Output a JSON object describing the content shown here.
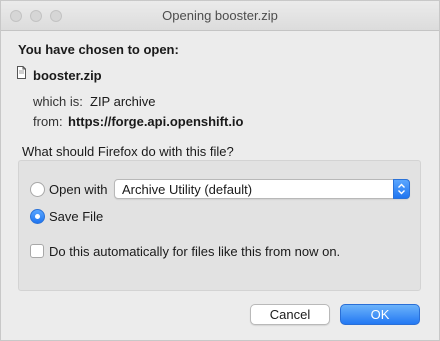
{
  "window": {
    "title": "Opening booster.zip"
  },
  "intro": {
    "heading": "You have chosen to open:"
  },
  "file": {
    "icon": "document-icon",
    "name": "booster.zip",
    "type_label": "which is:",
    "type_value": "ZIP archive",
    "from_label": "from:",
    "from_value": "https://forge.api.openshift.io"
  },
  "question": "What should Firefox do with this file?",
  "options": {
    "open_with_label": "Open with",
    "open_with_app": "Archive Utility (default)",
    "save_label": "Save File",
    "selected": "save",
    "auto_label": "Do this automatically for files like this from now on.",
    "auto_checked": false
  },
  "buttons": {
    "cancel": "Cancel",
    "ok": "OK"
  },
  "colors": {
    "accent": "#1f75f0"
  }
}
